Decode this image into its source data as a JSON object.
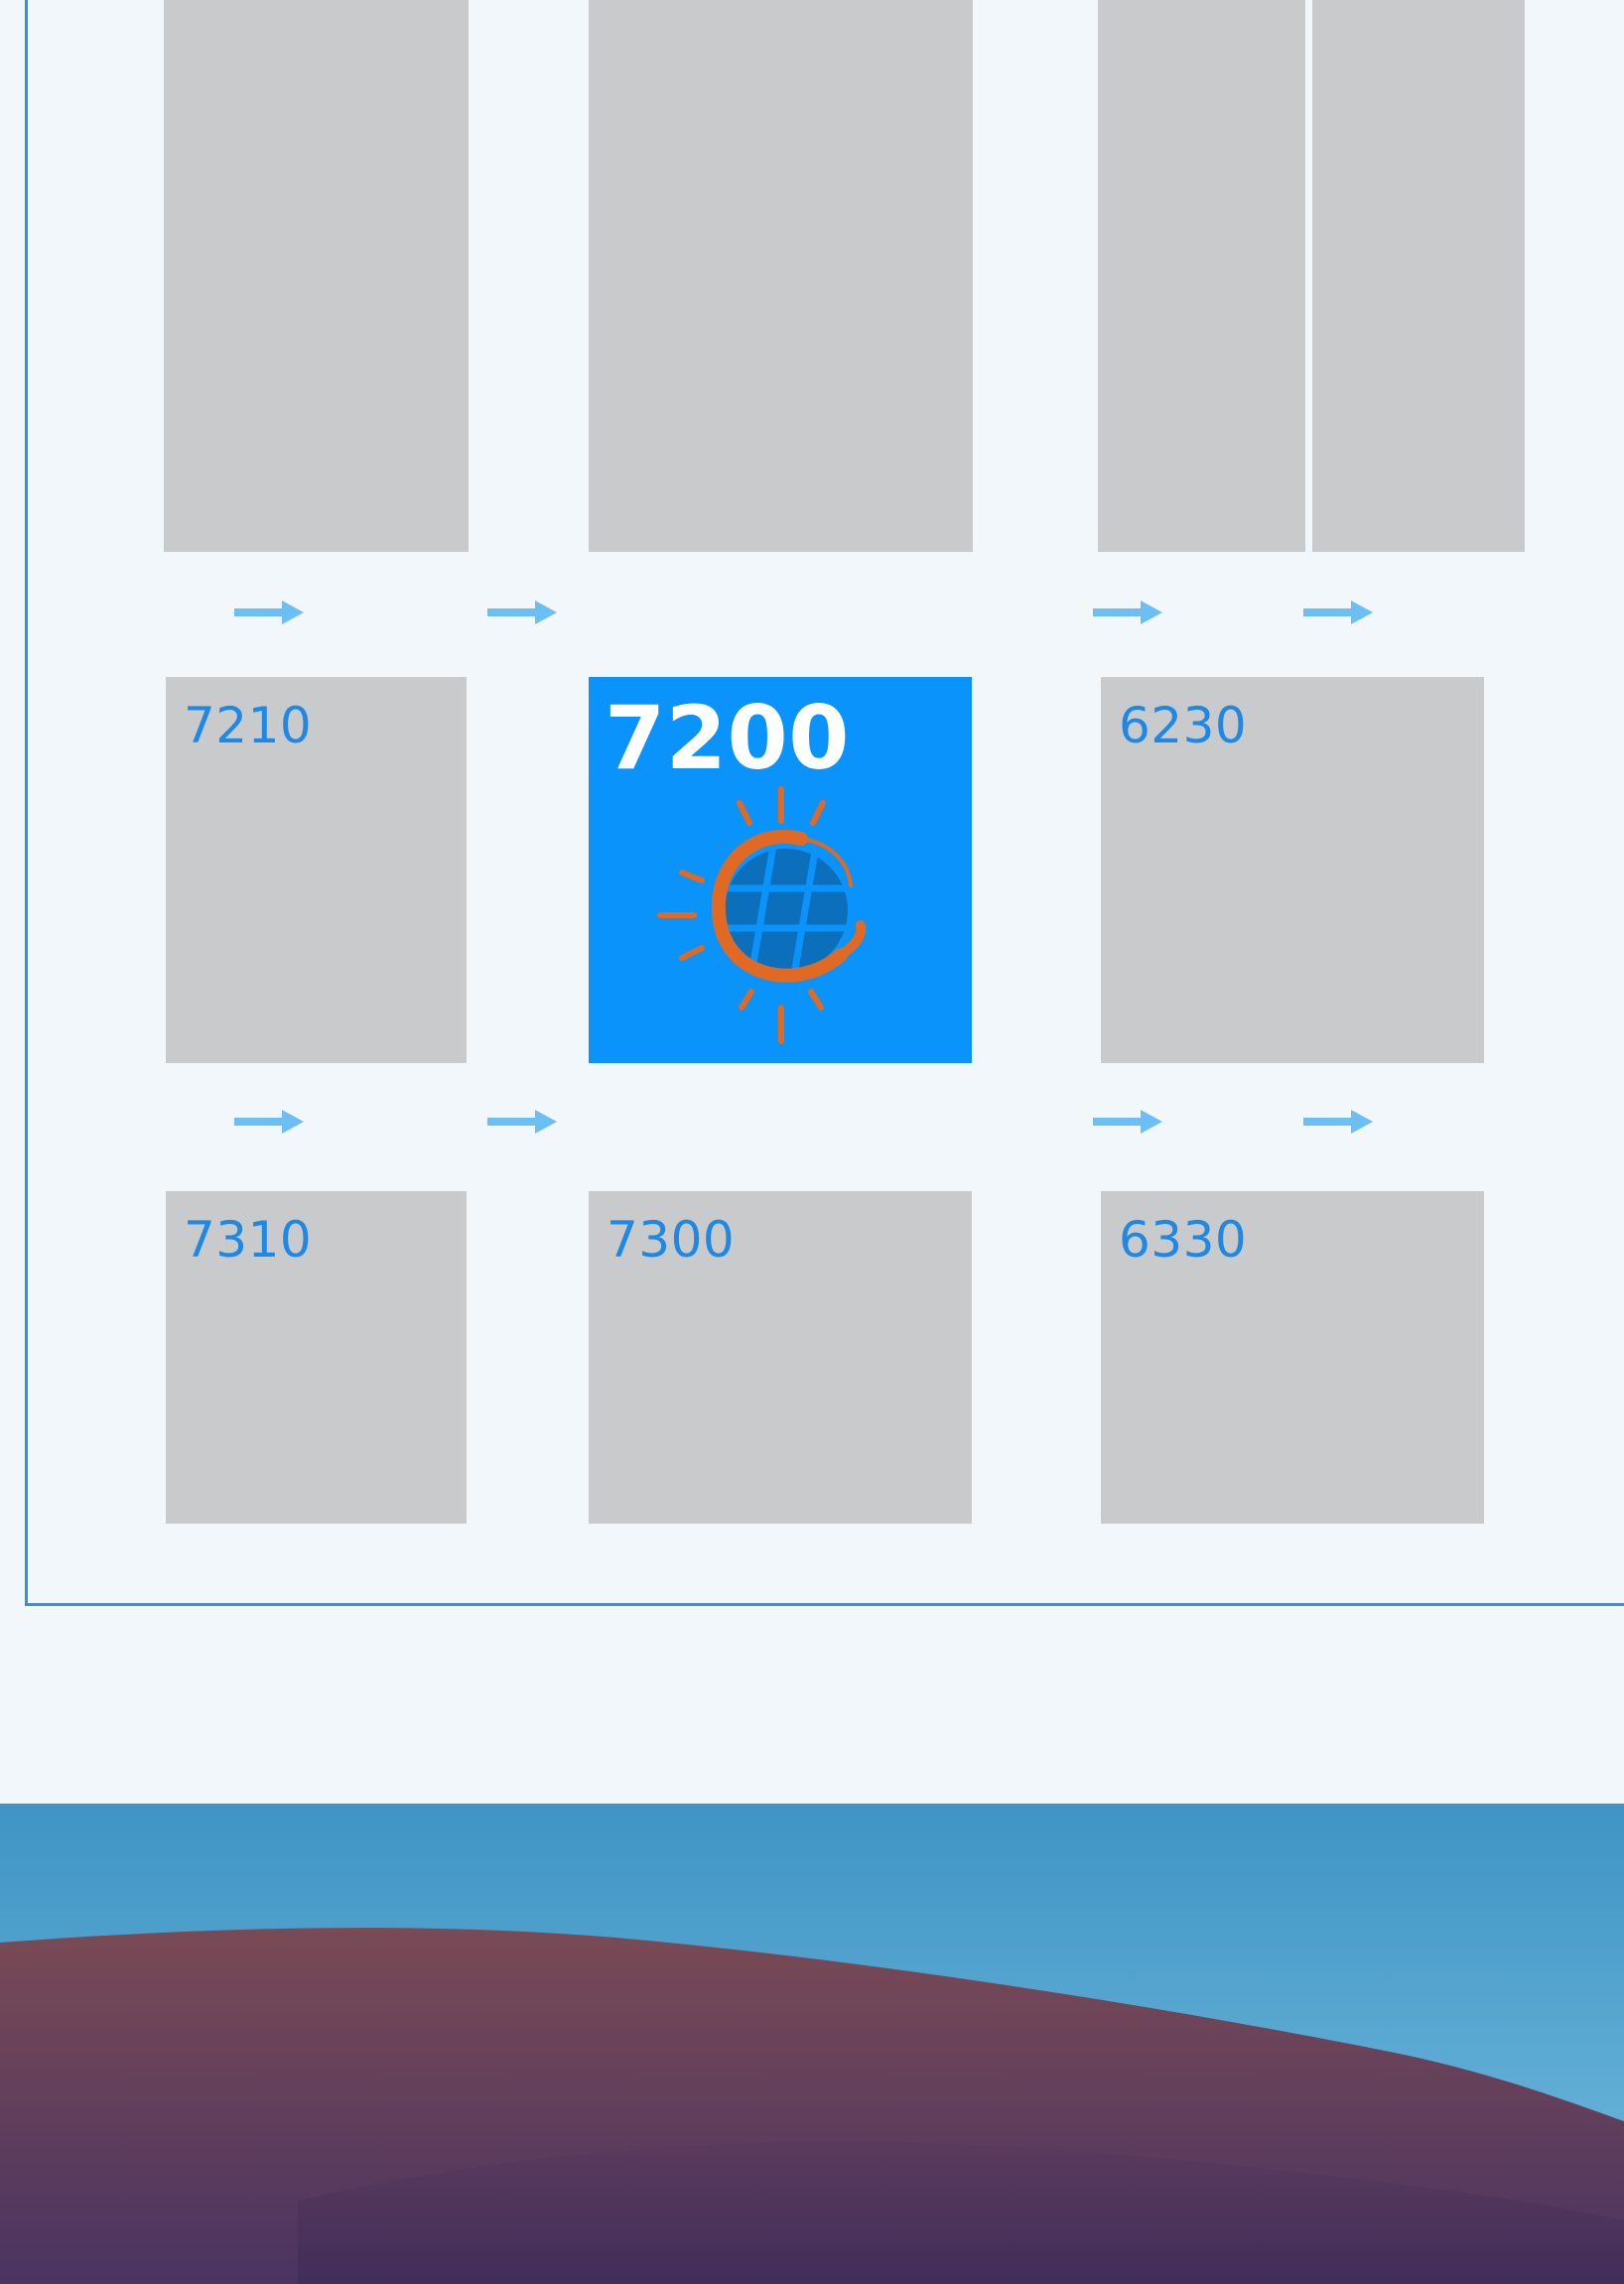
{
  "colors": {
    "background": "#f2f7fc",
    "frame": "#2b95e0",
    "box": "#c9cacb",
    "label": "#1e88e5",
    "highlight": "#0a93fb",
    "arrow": "#6cbff5",
    "logo_orange": "#e06a23",
    "logo_blue": "#0c6fbc"
  },
  "icons": {
    "arrow": "right-arrow-icon",
    "logo": "sun-globe-logo-icon"
  },
  "boxes": [
    {
      "label": "7210"
    },
    {
      "label": "7200",
      "highlighted": true
    },
    {
      "label": "6230"
    },
    {
      "label": "7310"
    },
    {
      "label": "7300"
    },
    {
      "label": "6330"
    }
  ]
}
